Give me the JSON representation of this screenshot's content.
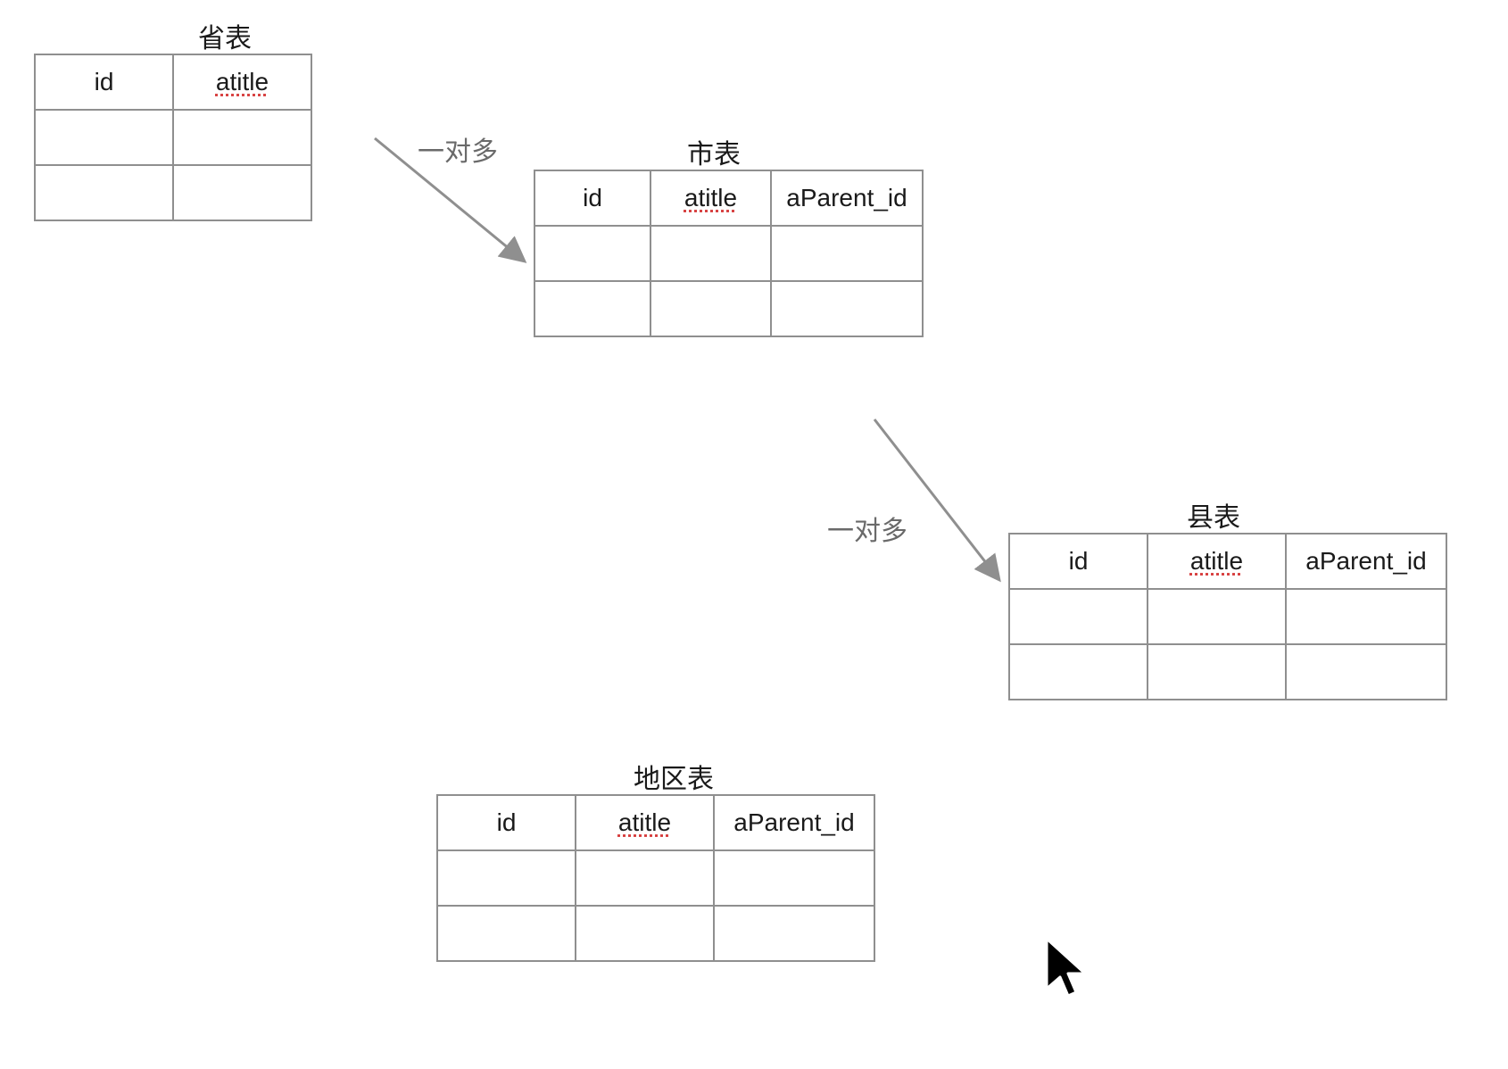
{
  "tables": {
    "province": {
      "title": "省表",
      "headers": [
        "id",
        "atitle"
      ]
    },
    "city": {
      "title": "市表",
      "headers": [
        "id",
        "atitle",
        "aParent_id"
      ]
    },
    "county": {
      "title": "县表",
      "headers": [
        "id",
        "atitle",
        "aParent_id"
      ]
    },
    "area": {
      "title": "地区表",
      "headers": [
        "id",
        "atitle",
        "aParent_id"
      ]
    }
  },
  "relations": {
    "r1": "一对多",
    "r2": "一对多"
  },
  "spellchecked_column": "atitle"
}
